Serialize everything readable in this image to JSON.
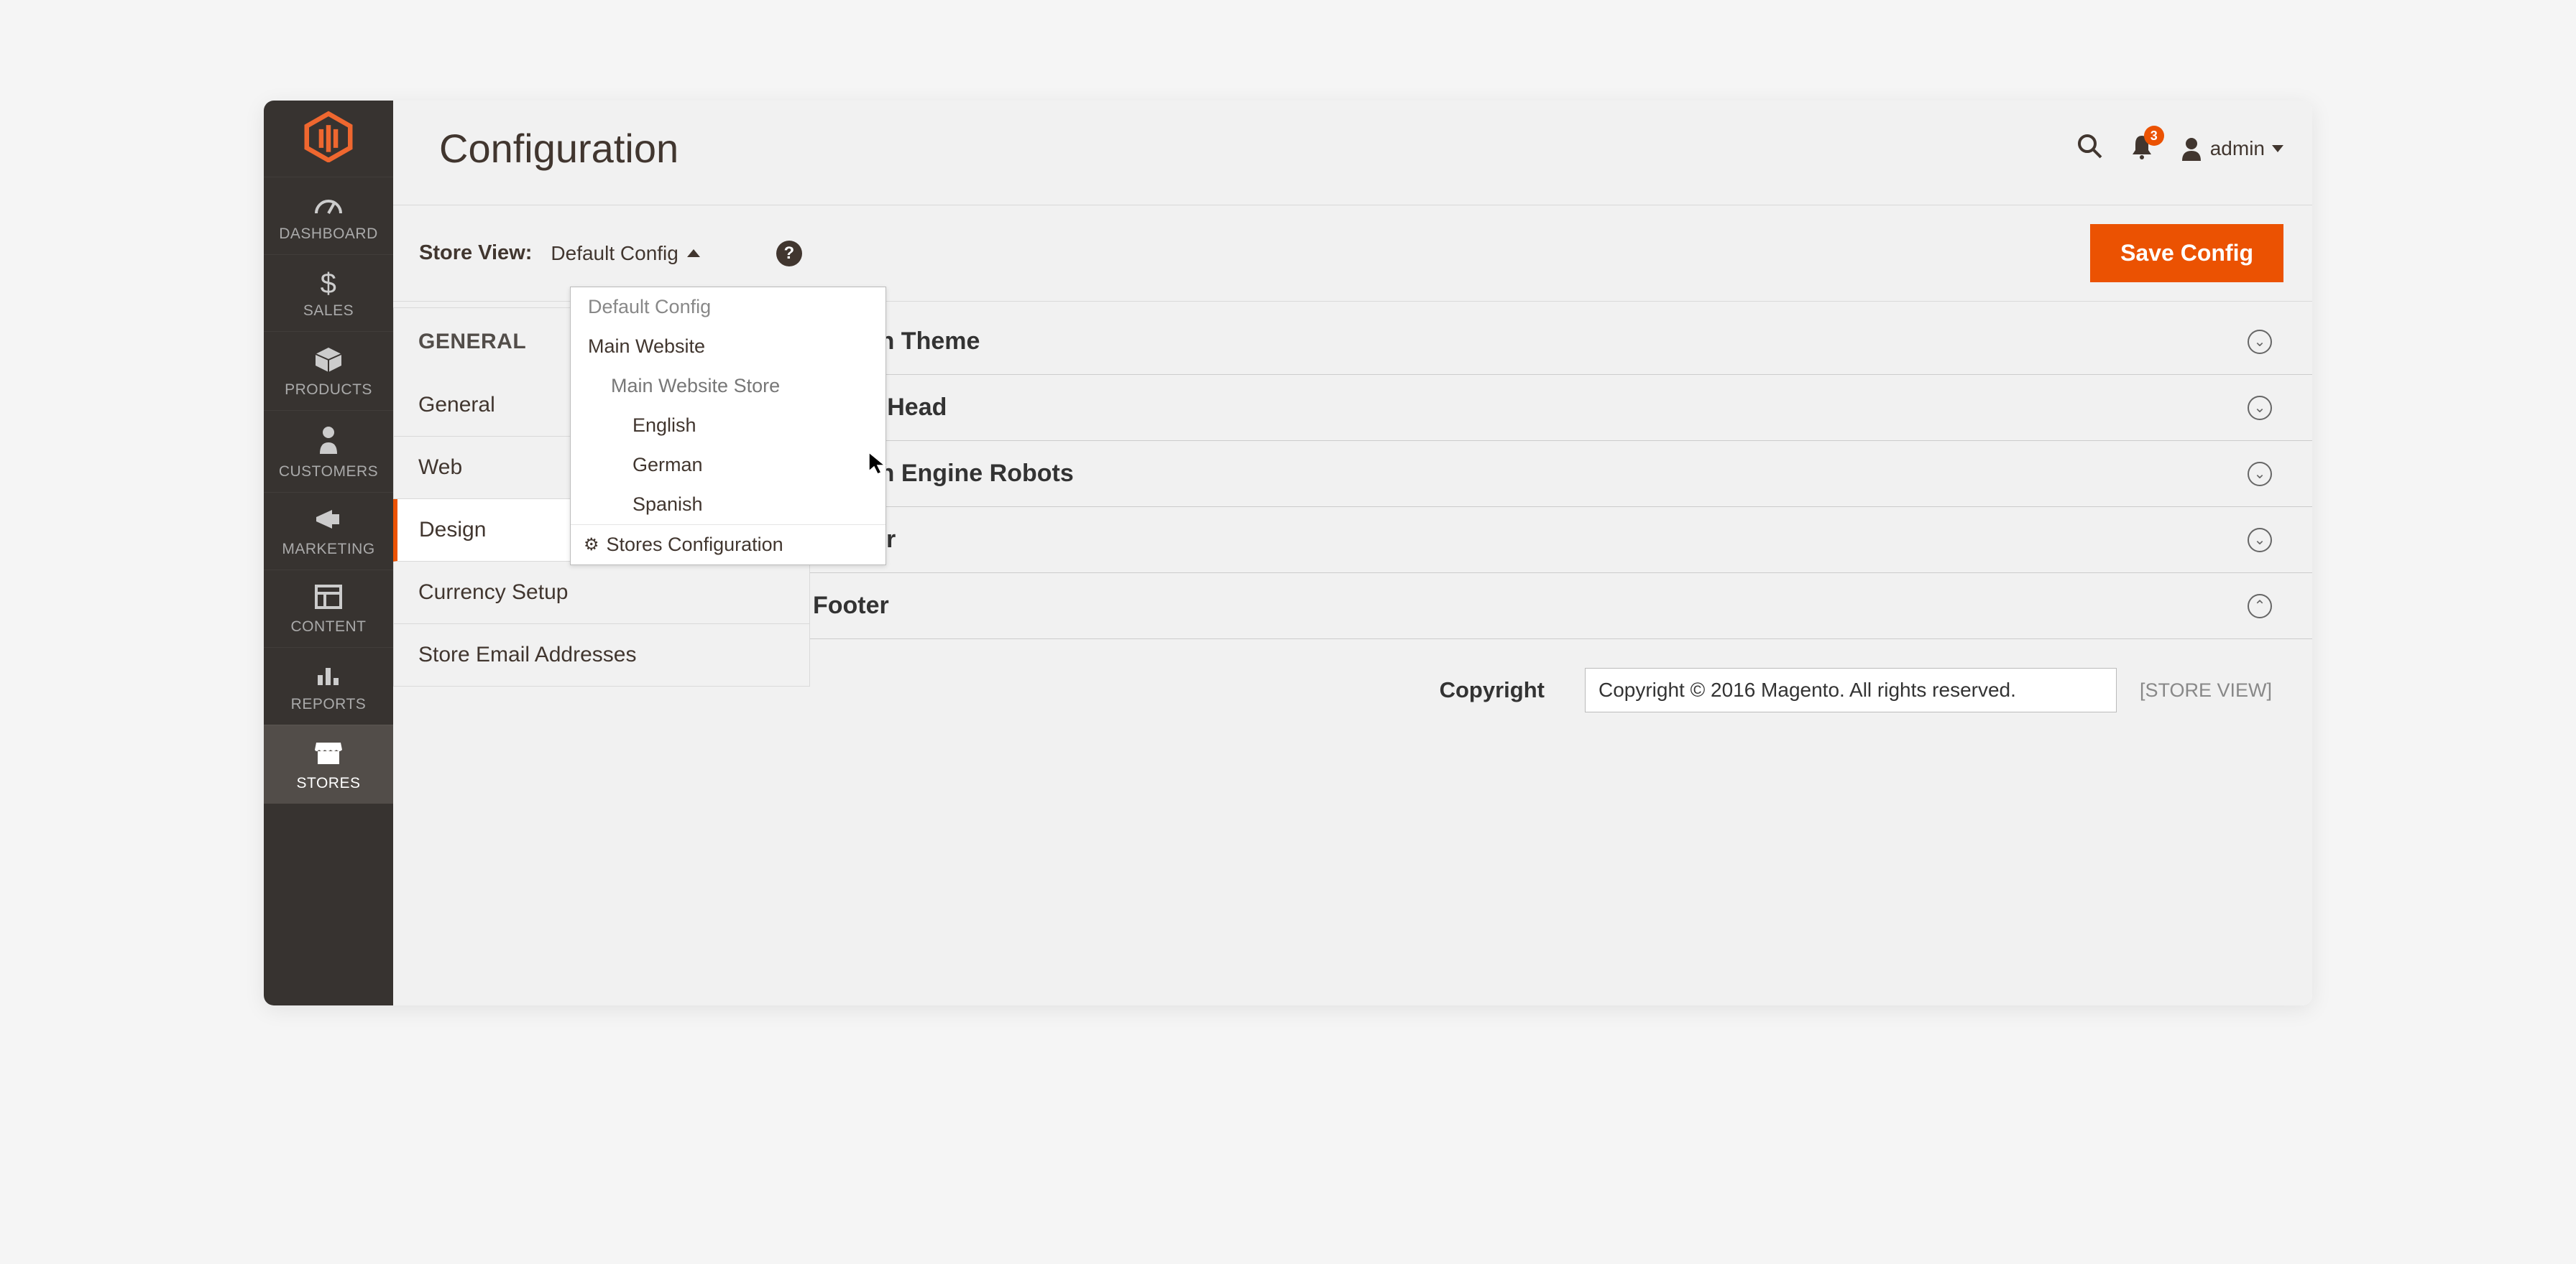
{
  "page_title": "Configuration",
  "nav": [
    {
      "label": "DASHBOARD"
    },
    {
      "label": "SALES"
    },
    {
      "label": "PRODUCTS"
    },
    {
      "label": "CUSTOMERS"
    },
    {
      "label": "MARKETING"
    },
    {
      "label": "CONTENT"
    },
    {
      "label": "REPORTS"
    },
    {
      "label": "STORES"
    }
  ],
  "notifications_count": "3",
  "user_label": "admin",
  "scope": {
    "label": "Store View:",
    "current": "Default Config",
    "options": {
      "default": "Default Config",
      "website": "Main Website",
      "store": "Main Website Store",
      "view_en": "English",
      "view_de": "German",
      "view_es": "Spanish",
      "stores_config": "Stores Configuration"
    }
  },
  "save_button": "Save Config",
  "tabs": {
    "group": "GENERAL",
    "items": [
      "General",
      "Web",
      "Design",
      "Currency Setup",
      "Store Email Addresses"
    ],
    "active_index": 2
  },
  "sections": [
    "Design Theme",
    "HTML Head",
    "Search Engine Robots",
    "Header",
    "Footer"
  ],
  "footer_field": {
    "label": "Copyright",
    "value": "Copyright © 2016 Magento. All rights reserved.",
    "scope": "[STORE VIEW]"
  }
}
